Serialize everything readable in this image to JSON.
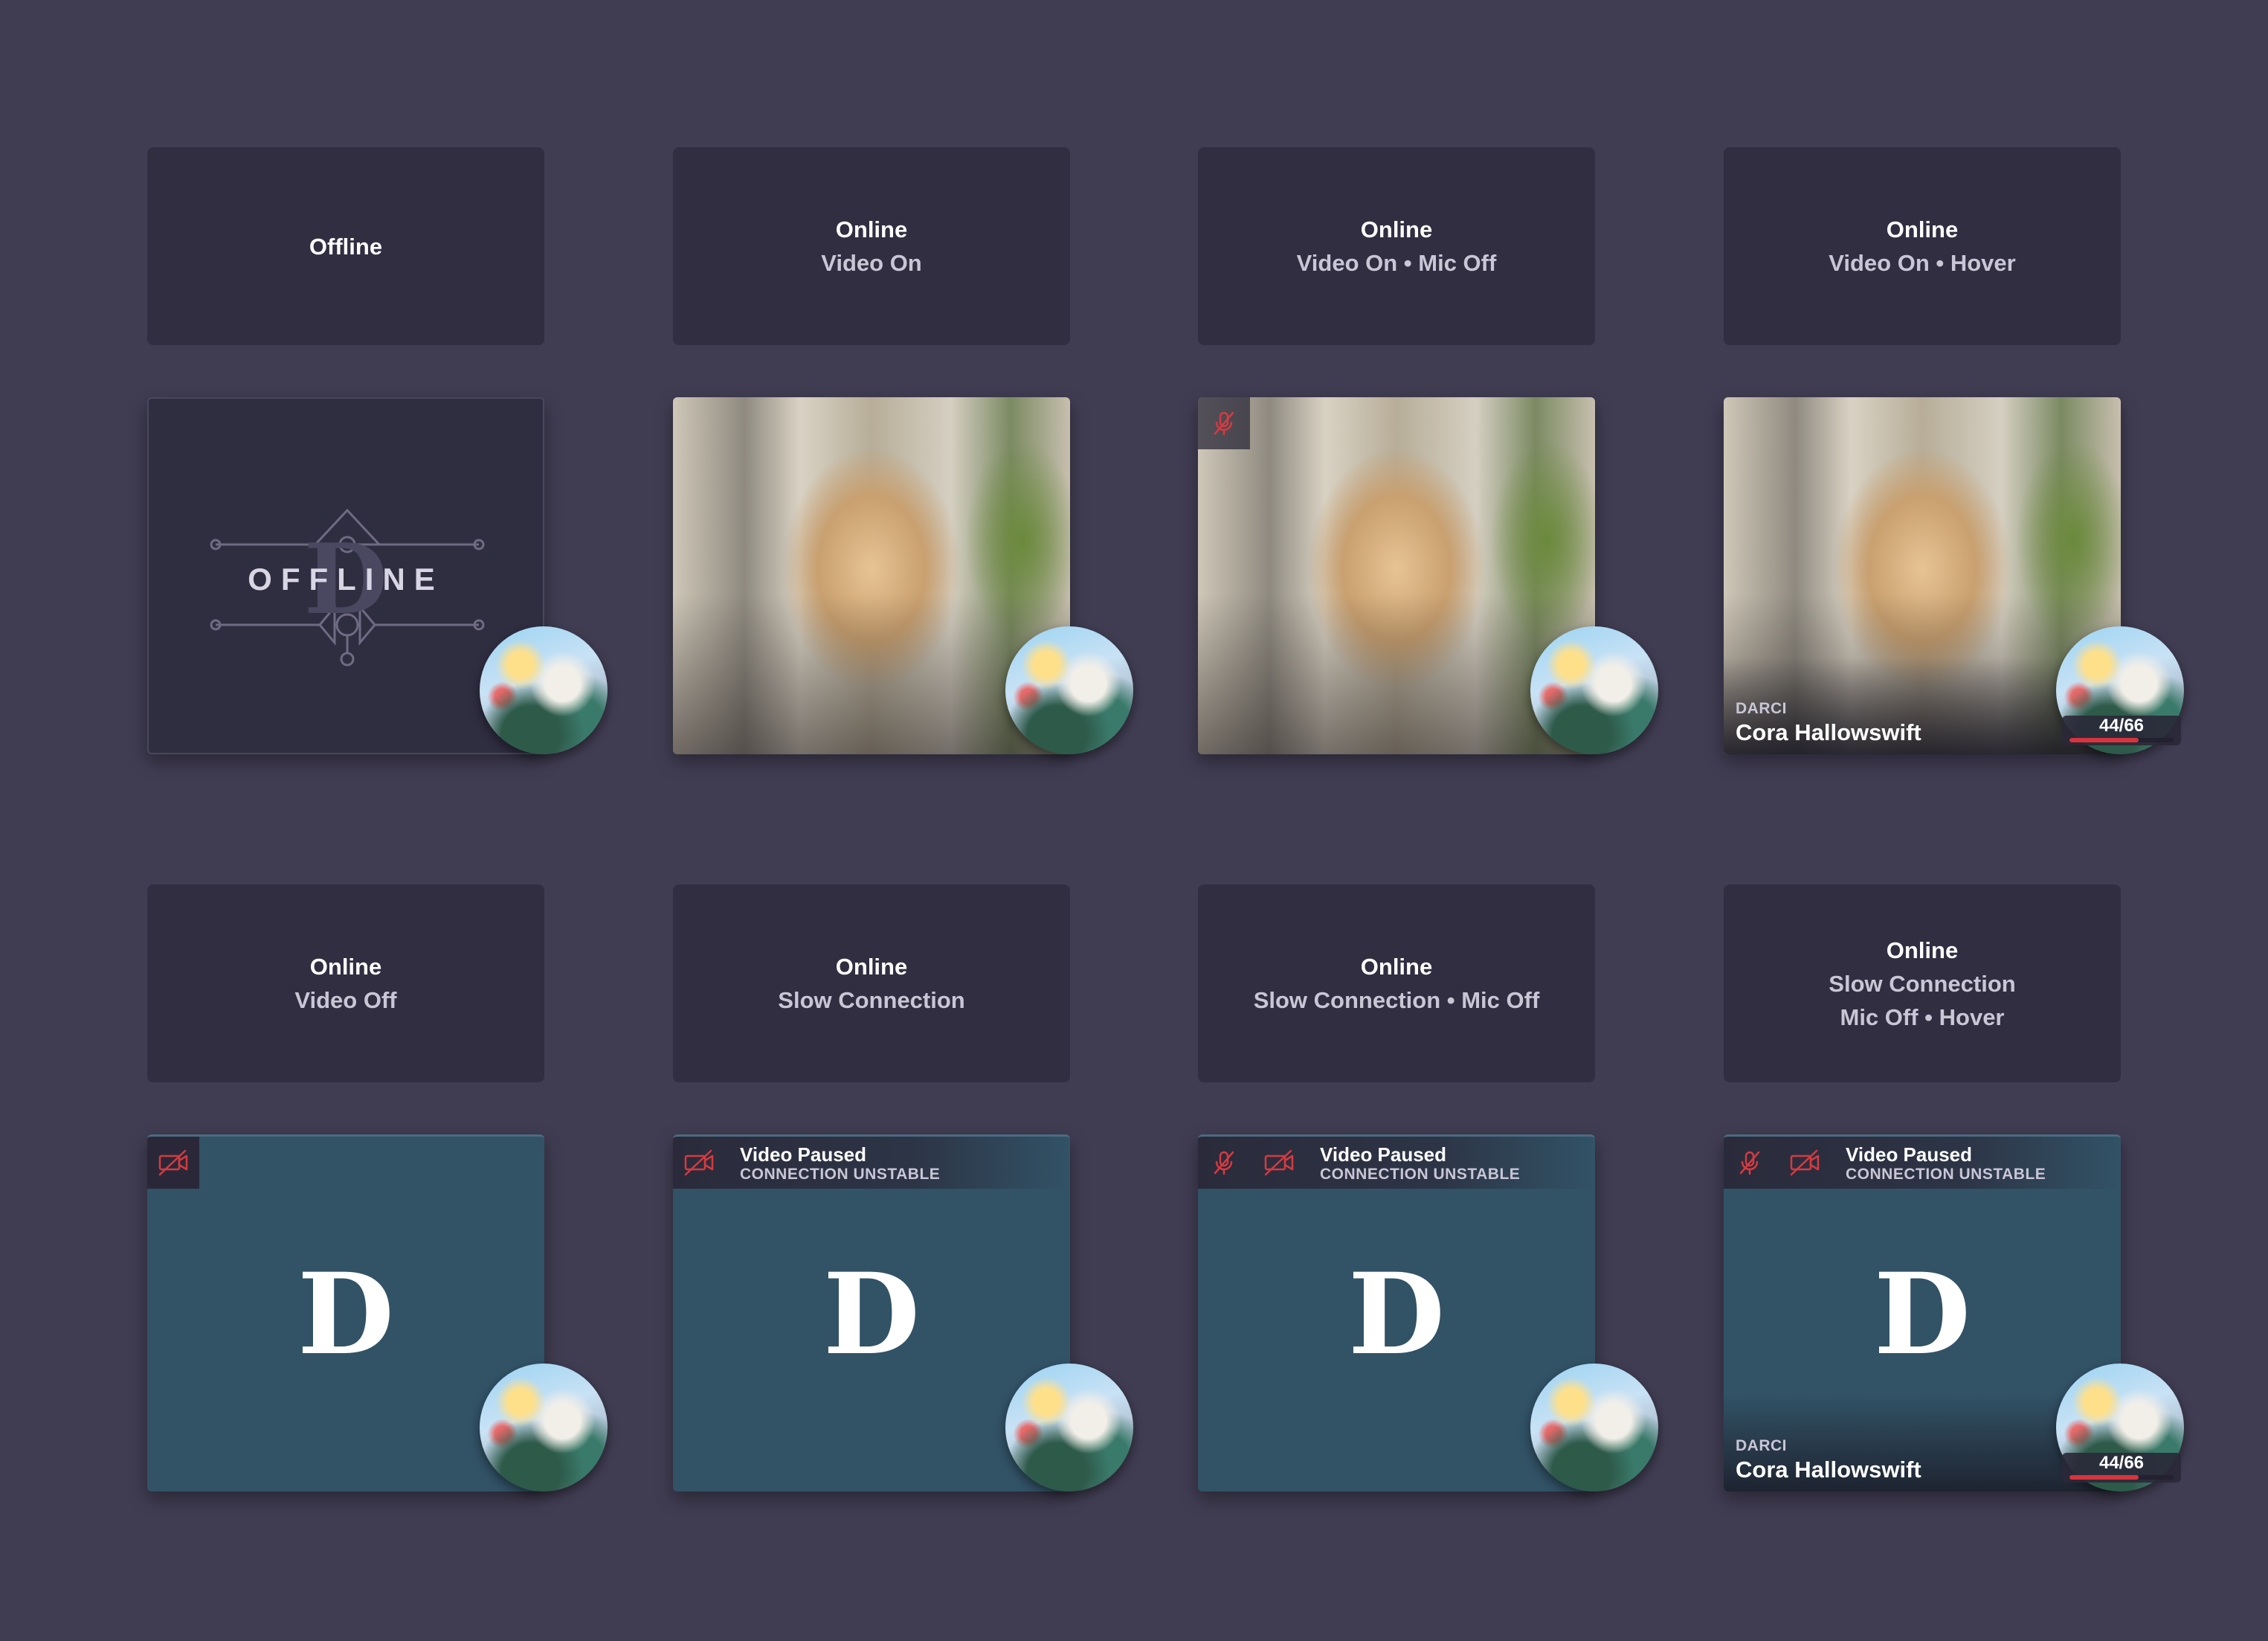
{
  "labels": [
    {
      "status": "Offline",
      "lines": []
    },
    {
      "status": "Online",
      "lines": [
        "Video On"
      ]
    },
    {
      "status": "Online",
      "lines": [
        "Video On • Mic Off"
      ]
    },
    {
      "status": "Online",
      "lines": [
        "Video On • Hover"
      ]
    },
    {
      "status": "Online",
      "lines": [
        "Video Off"
      ]
    },
    {
      "status": "Online",
      "lines": [
        "Slow Connection"
      ]
    },
    {
      "status": "Online",
      "lines": [
        "Slow Connection • Mic Off"
      ]
    },
    {
      "status": "Online",
      "lines": [
        "Slow Connection",
        "Mic Off • Hover"
      ]
    }
  ],
  "offline_tile": {
    "text": "OFFLINE",
    "letter": "D"
  },
  "tile_letter": "D",
  "video_paused": {
    "title": "Video Paused",
    "subtitle": "CONNECTION UNSTABLE"
  },
  "participant": {
    "role": "DARCI",
    "name": "Cora Hallowswift"
  },
  "level": {
    "text": "44/66",
    "current": 44,
    "max": 66
  },
  "colors": {
    "accent_red": "#d9343d",
    "icon_red": "#d63a3f",
    "tile_teal": "#325266",
    "page_bg": "#403c52",
    "card_bg": "#312e41"
  },
  "icons": {
    "mic_off": "mic-off-icon",
    "video_off": "video-off-icon"
  }
}
